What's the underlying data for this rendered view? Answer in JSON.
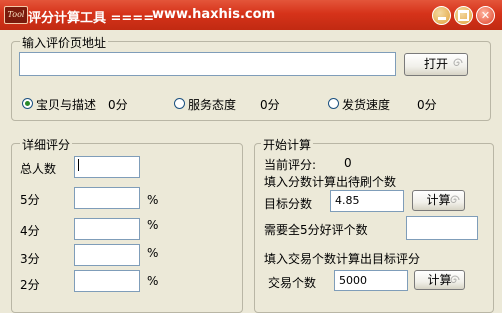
{
  "window": {
    "icon_text": "Tool",
    "title": "评分计算工具 ====",
    "url": "www.haxhis.com"
  },
  "url_group": {
    "label": "输入评价页地址",
    "url_value": "",
    "open_button": "打开"
  },
  "ratings": [
    {
      "label": "宝贝与描述",
      "value": "0分",
      "selected": true
    },
    {
      "label": "服务态度",
      "value": "0分",
      "selected": false
    },
    {
      "label": "发货速度",
      "value": "0分",
      "selected": false
    }
  ],
  "detail_group": {
    "label": "详细评分",
    "total_label": "总人数",
    "total_value": "",
    "rows": [
      {
        "label": "5分",
        "value": "",
        "unit": "%"
      },
      {
        "label": "4分",
        "value": "",
        "unit": "%"
      },
      {
        "label": "3分",
        "value": "",
        "unit": "%"
      },
      {
        "label": "2分",
        "value": "",
        "unit": "%"
      }
    ]
  },
  "calc_group": {
    "label": "开始计算",
    "current_label": "当前评分:",
    "current_value": "0",
    "section1_title": "填入分数计算出待刷个数",
    "target_label": "目标分数",
    "target_value": "4.85",
    "calc_button": "计算",
    "need_label": "需要全5分好评个数",
    "need_value": "",
    "section2_title": "填入交易个数计算出目标评分",
    "trade_label": "交易个数",
    "trade_value": "5000",
    "calc_button2": "计算"
  }
}
